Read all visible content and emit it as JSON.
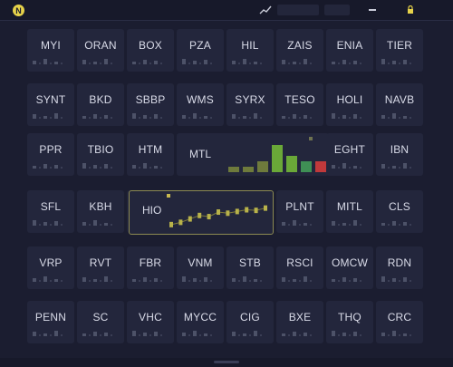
{
  "app": {
    "logo_letter": "N",
    "toolbar": {
      "icons": [
        "trend-icon",
        "dropdown-icon",
        "lock-icon"
      ]
    }
  },
  "grid": {
    "rows": [
      [
        "MYI",
        "ORAN",
        "BOX",
        "PZA",
        "HIL",
        "ZAIS",
        "ENIA",
        "TIER"
      ],
      [
        "SYNT",
        "BKD",
        "SBBP",
        "WMS",
        "SYRX",
        "TESO",
        "HOLI",
        "NAVB"
      ],
      [
        "PPR",
        "TBIO",
        "HTM",
        "MTL",
        "",
        "",
        "EGHT",
        "IBN"
      ],
      [
        "SFL",
        "KBH",
        "HIO",
        "",
        "",
        "PLNT",
        "MITL",
        "CLS"
      ],
      [
        "VRP",
        "RVT",
        "FBR",
        "VNM",
        "STB",
        "RSCI",
        "OMCW",
        "RDN"
      ],
      [
        "PENN",
        "SC",
        "VHC",
        "MYCC",
        "CIG",
        "BXE",
        "THQ",
        "CRC"
      ]
    ]
  },
  "expanded_tiles": {
    "mtl": {
      "symbol": "MTL"
    },
    "hio": {
      "symbol": "HIO"
    }
  },
  "chart_data": [
    {
      "type": "bar",
      "series": [
        {
          "values": [
            1,
            1,
            2,
            5,
            3,
            2,
            2
          ]
        }
      ],
      "colors": [
        "#6e7a3c",
        "#6e7a3c",
        "#6e7a3c",
        "#6aa838",
        "#6aa838",
        "#3f8f55",
        "#c0393b"
      ]
    },
    {
      "type": "line",
      "series": [
        {
          "values": [
            1.0,
            1.4,
            2.0,
            2.6,
            2.4,
            3.2,
            3.0,
            3.3,
            3.6,
            3.5,
            3.9
          ]
        }
      ],
      "colors": [
        "#b8b24a"
      ]
    }
  ],
  "colors": {
    "background": "#1b1d30",
    "tile": "#23263c",
    "highlight_border": "#8c8a52",
    "accent": "#e6d24a"
  }
}
